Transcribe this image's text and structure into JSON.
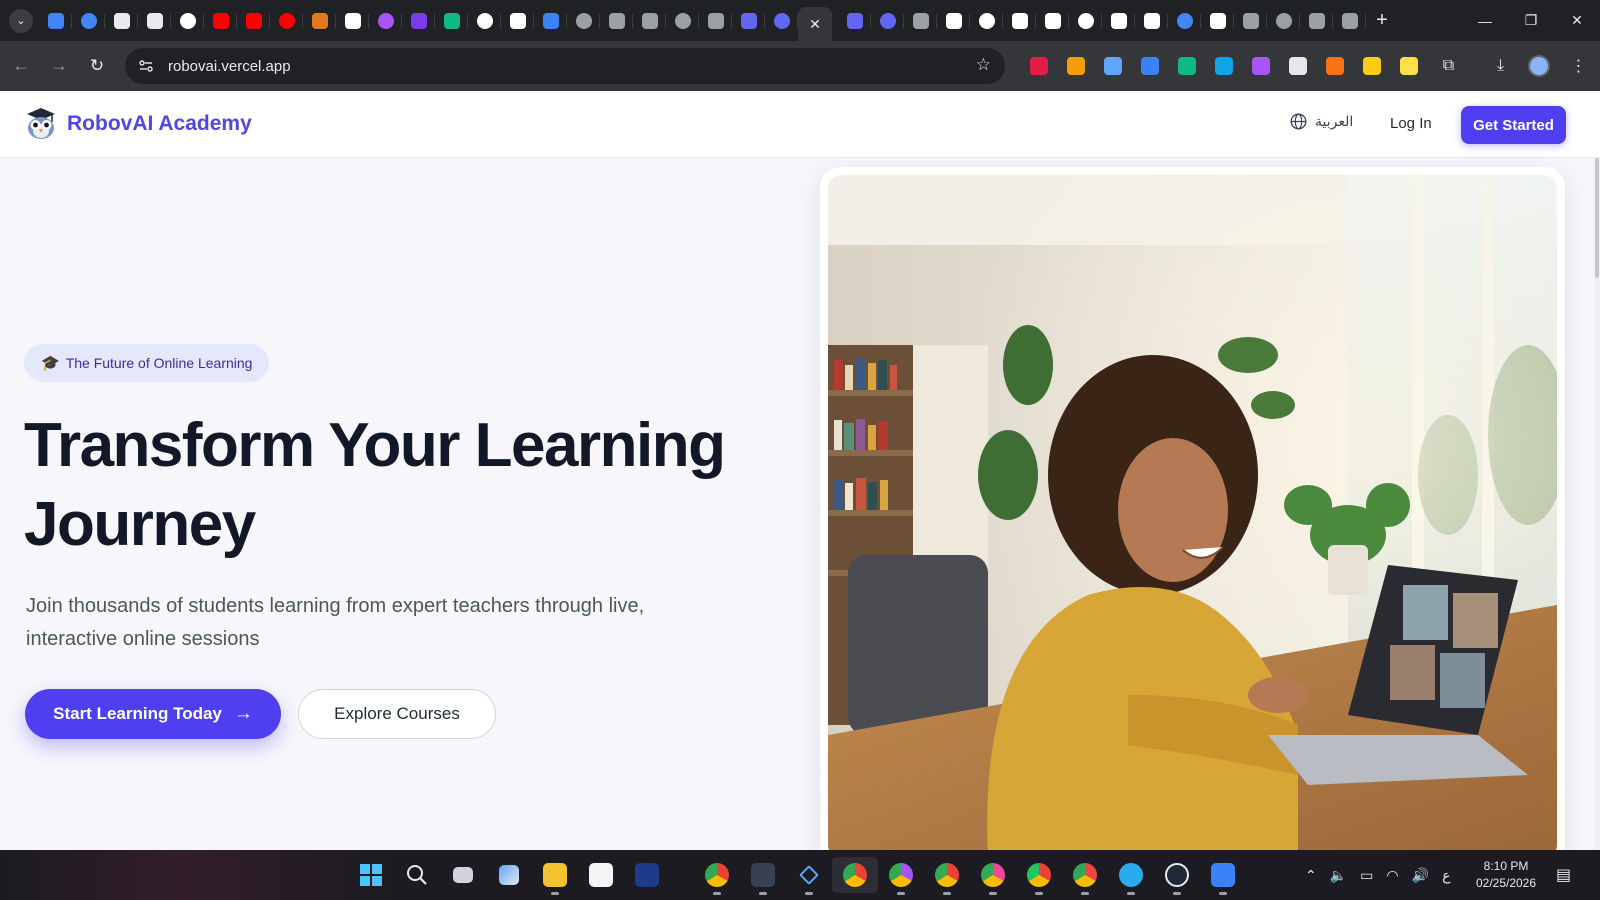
{
  "browser": {
    "active_tab_close": "✕",
    "new_tab": "+",
    "url": "robovai.vercel.app",
    "window_controls": {
      "minimize": "—",
      "restore": "❐",
      "close": "✕"
    },
    "tab_favicon_colors": [
      "#4285f4",
      "#4285f4",
      "#e8eaed",
      "#e8eaed",
      "#ffffff",
      "#ff0000",
      "#ff0000",
      "#ff0000",
      "#e07a1f",
      "#ffffff",
      "#a855f7",
      "#7c3aed",
      "#10b981",
      "#ffffff",
      "#ffffff",
      "#3b82f6",
      "#9aa0a6",
      "#9aa0a6",
      "#9aa0a6",
      "#9aa0a6",
      "#9aa0a6",
      "#6366f1",
      "#6366f1"
    ],
    "tab_favicon_colors_after": [
      "#6366f1",
      "#6366f1",
      "#9aa0a6",
      "#ffffff",
      "#ffffff",
      "#ffffff",
      "#ffffff",
      "#ffffff",
      "#ffffff",
      "#ffffff",
      "#4285f4",
      "#ffffff",
      "#9aa0a6",
      "#9aa0a6",
      "#9aa0a6",
      "#9aa0a6"
    ],
    "extension_colors": [
      "#e11d48",
      "#f59e0b",
      "#60a5fa",
      "#3b82f6",
      "#10b981",
      "#0ea5e9",
      "#a855f7",
      "#e5e7eb",
      "#f97316",
      "#facc15",
      "#fde047"
    ]
  },
  "site": {
    "brand": "RobovAI Academy",
    "language": "العربية",
    "login": "Log In",
    "get_started": "Get Started",
    "accent": "#4f3ff0"
  },
  "hero": {
    "badge": "The Future of Online Learning",
    "badge_icon": "graduation-cap-icon",
    "title": "Transform Your Learning Journey",
    "subtitle": "Join thousands of students learning from expert teachers through live, interactive online sessions",
    "primary_cta": "Start Learning Today",
    "secondary_cta": "Explore Courses"
  },
  "taskbar": {
    "time": "8:10 PM",
    "date": "02/25/2026",
    "tray_language": "ع"
  }
}
